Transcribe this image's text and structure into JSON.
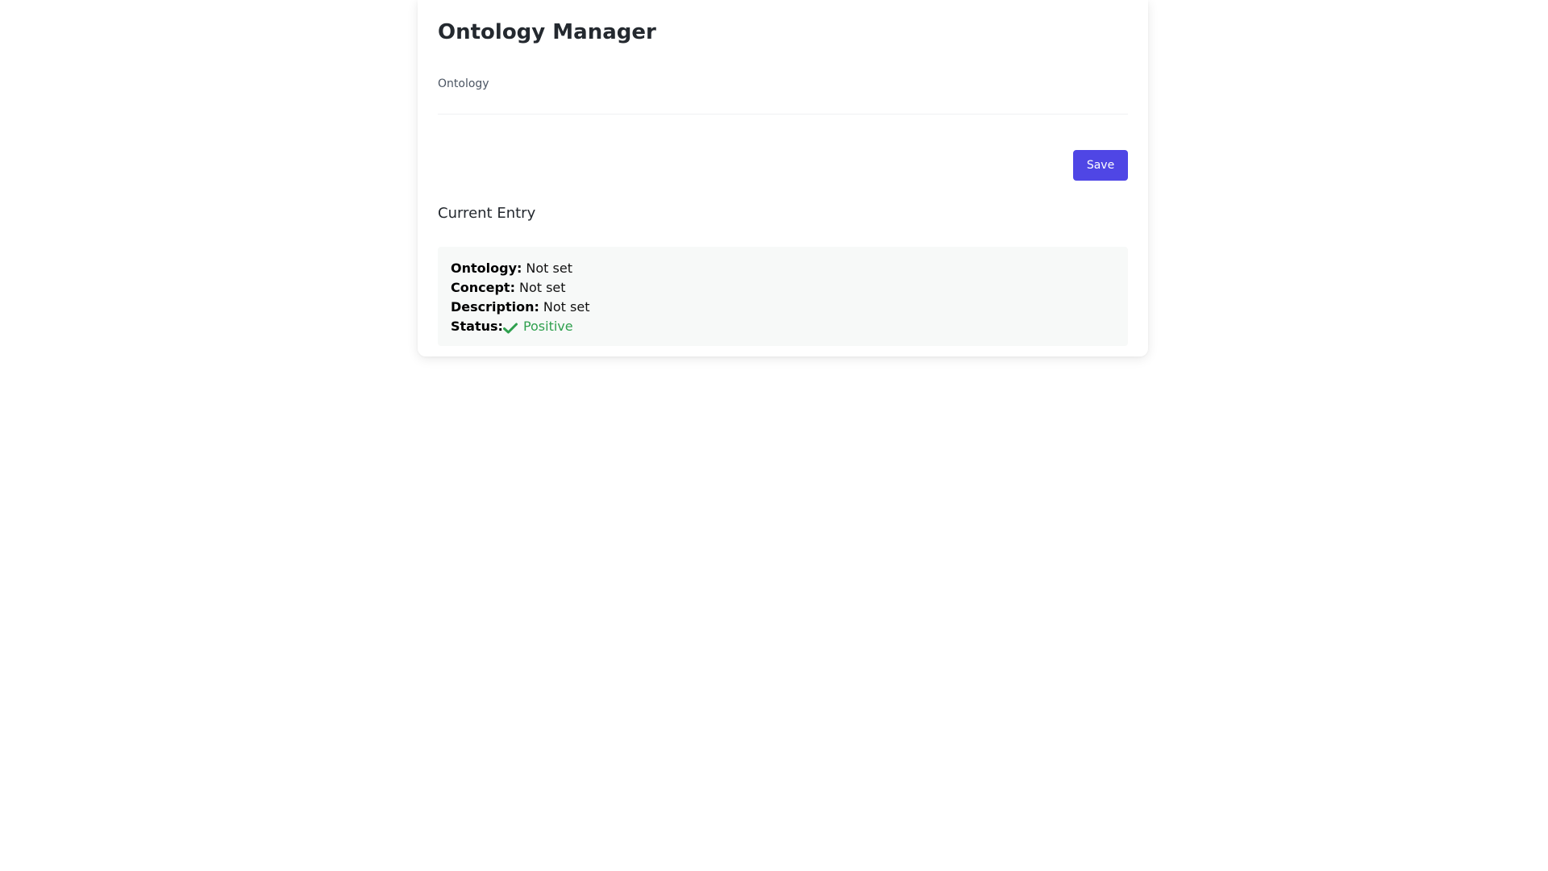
{
  "app": {
    "title": "Ontology Manager"
  },
  "form": {
    "ontology_label": "Ontology",
    "ontology_value": "",
    "save_label": "Save"
  },
  "current_entry": {
    "heading": "Current Entry",
    "fields": [
      {
        "key": "Ontology:",
        "value": "Not set"
      },
      {
        "key": "Concept:",
        "value": "Not set"
      },
      {
        "key": "Description:",
        "value": "Not set"
      }
    ],
    "status": {
      "key": "Status:",
      "value": "Positive",
      "icon": "checkmark-icon",
      "color": "#2fa04e"
    }
  },
  "colors": {
    "accent": "#4f46e5",
    "status_positive": "#2fa04e",
    "entry_background": "#f7f9f8"
  }
}
